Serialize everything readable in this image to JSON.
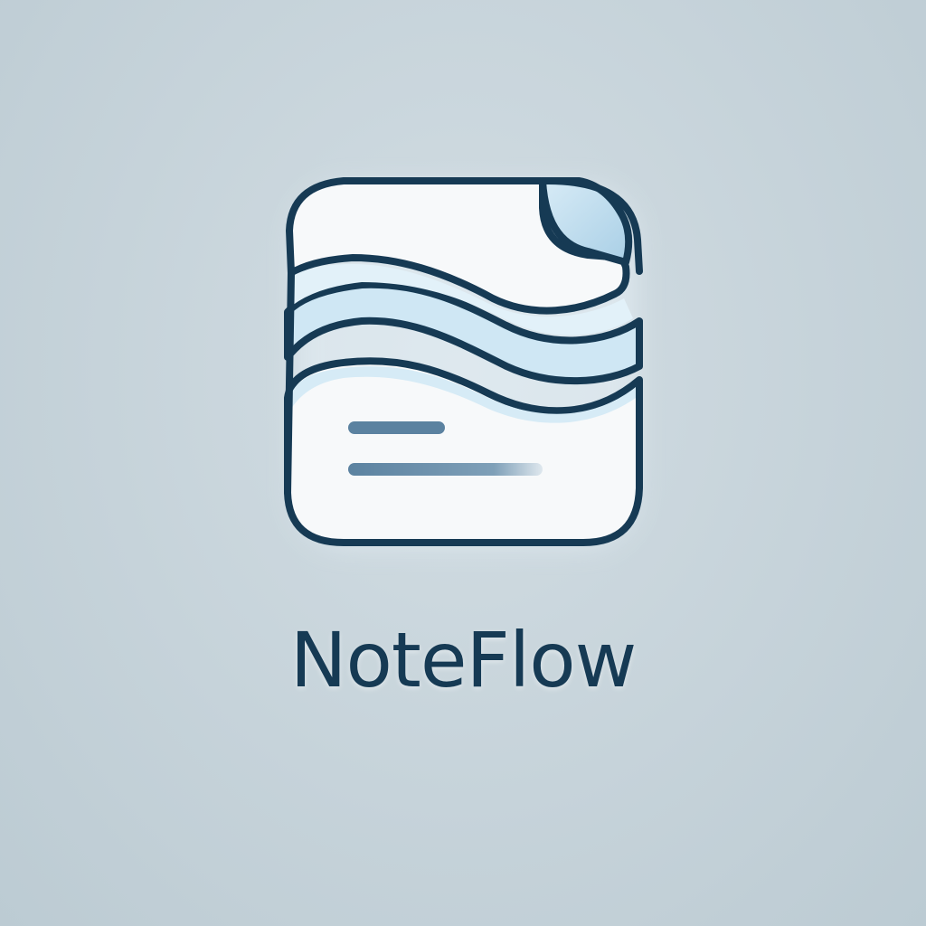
{
  "brand": {
    "name": "NoteFlow"
  },
  "colors": {
    "background": "#c6d3da",
    "outline": "#163a54",
    "page_fill": "#f7f9fa",
    "wave_band": "#cfe7f4",
    "text_lines": "#5b82a0"
  },
  "icon": {
    "name": "noteflow-logo-icon"
  }
}
